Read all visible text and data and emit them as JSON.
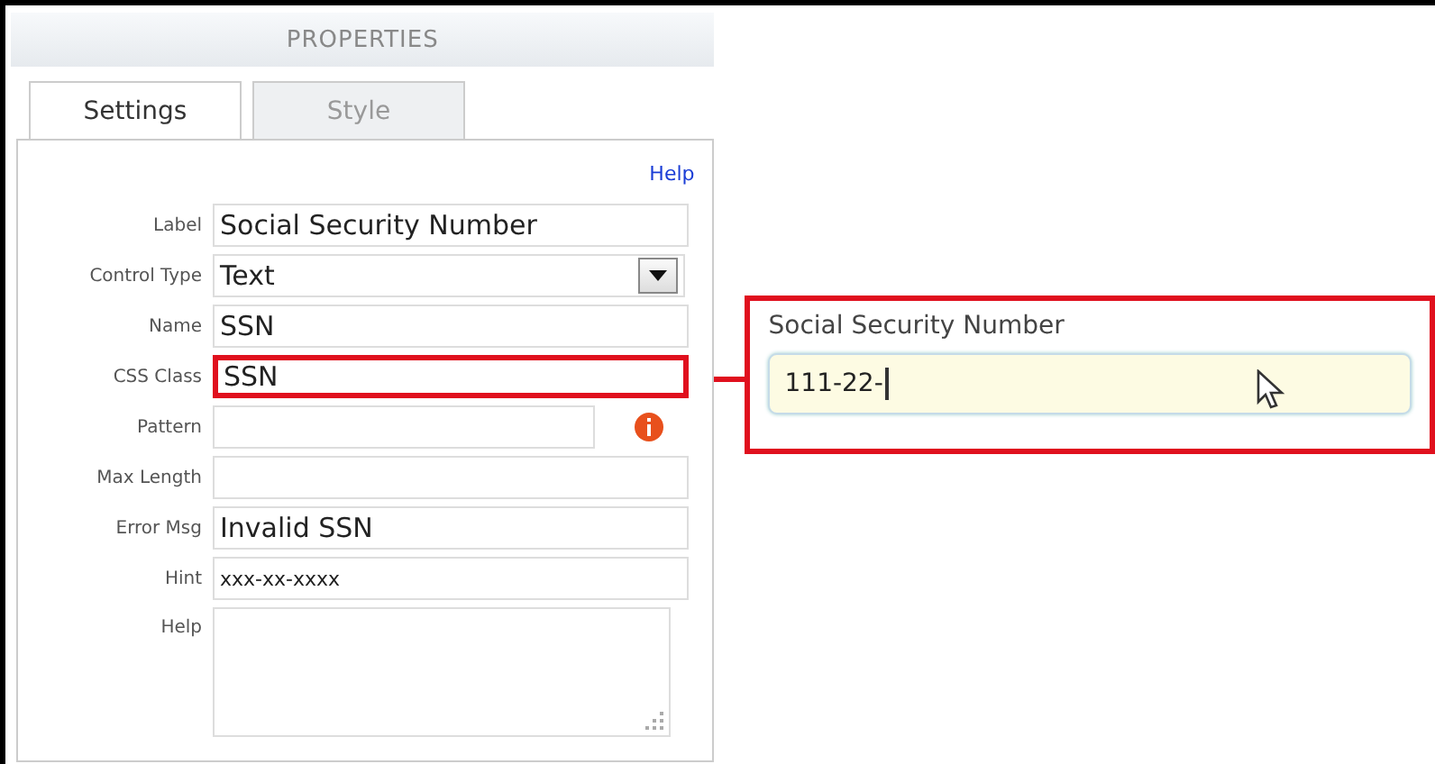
{
  "panel": {
    "title": "PROPERTIES",
    "help_link": "Help"
  },
  "tabs": [
    {
      "label": "Settings",
      "selected": true
    },
    {
      "label": "Style",
      "selected": false
    }
  ],
  "fields": [
    {
      "label": "Label",
      "kind": "text",
      "value": "Social Security Number",
      "highlighted": false,
      "info": false
    },
    {
      "label": "Control Type",
      "kind": "select",
      "value": "Text",
      "highlighted": false,
      "info": false
    },
    {
      "label": "Name",
      "kind": "text",
      "value": "SSN",
      "highlighted": false,
      "info": false
    },
    {
      "label": "CSS Class",
      "kind": "text",
      "value": "SSN",
      "highlighted": true,
      "info": false
    },
    {
      "label": "Pattern",
      "kind": "text",
      "highlighted": false,
      "info": true
    },
    {
      "label": "Max Length",
      "kind": "text",
      "highlighted": false,
      "info": false
    },
    {
      "label": "Error Msg",
      "kind": "text",
      "value": "Invalid SSN",
      "highlighted": false,
      "info": false
    },
    {
      "label": "Hint",
      "kind": "hint",
      "value": "xxx-xx-xxxx",
      "highlighted": false,
      "info": false
    },
    {
      "label": "Help",
      "kind": "textarea",
      "highlighted": false,
      "info": false
    }
  ],
  "preview": {
    "label": "Social Security Number",
    "value": "111-22-",
    "focused": true
  }
}
